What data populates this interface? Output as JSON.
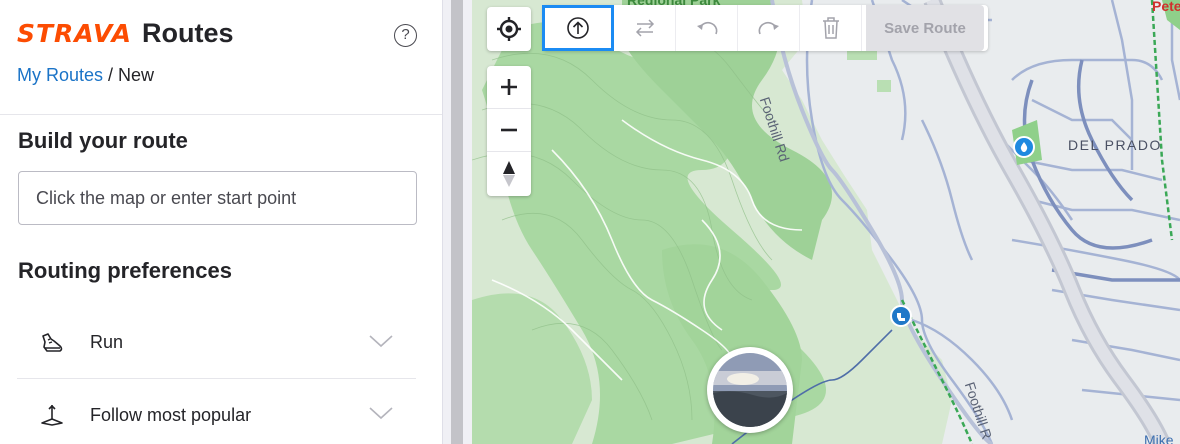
{
  "app": {
    "brand": "STRAVA",
    "product": "Routes",
    "help_label": "?"
  },
  "breadcrumb": {
    "parent": "My Routes",
    "separator": " / ",
    "current": "New"
  },
  "builder": {
    "title": "Build your route",
    "start_placeholder": "Click the map or enter start point",
    "start_value": ""
  },
  "preferences": {
    "title": "Routing preferences",
    "items": [
      {
        "label": "Run",
        "icon": "shoe-icon"
      },
      {
        "label": "Follow most popular",
        "icon": "popular-route-icon"
      }
    ]
  },
  "map": {
    "labels": {
      "park": "Regional Park",
      "road_north": "Foothill Rd",
      "road_south": "Foothill R",
      "neighborhood": "DEL PRADO",
      "corner_top": "Pete",
      "corner_bottom": "Mike"
    },
    "toolbar": {
      "save_label": "Save Route",
      "buttons": [
        "upload-gpx-icon",
        "reverse-route-icon",
        "undo-icon",
        "redo-icon",
        "trash-icon"
      ]
    },
    "controls": {
      "zoom_in": "+",
      "zoom_out": "−"
    },
    "colors": {
      "green_area": "#a8d8a0",
      "road": "#9aa7c9",
      "highway": "#c9ccd6",
      "trail_green": "#3aa856",
      "selected_outline": "#1b8bf3",
      "brand": "#fc4c02"
    }
  }
}
